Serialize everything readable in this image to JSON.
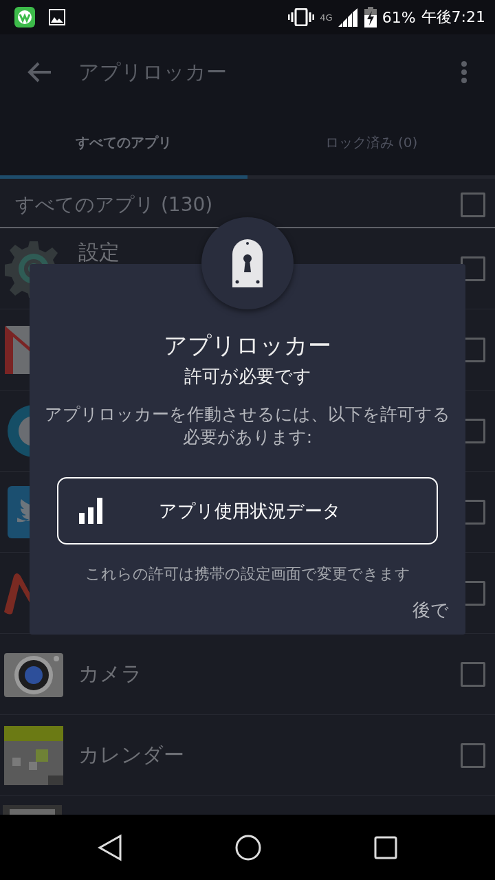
{
  "status_bar": {
    "network": "4G",
    "battery": "61%",
    "time": "午後7:21"
  },
  "app_bar": {
    "title": "アプリロッカー"
  },
  "tabs": [
    {
      "label": "すべてのアプリ",
      "selected": true
    },
    {
      "label": "ロック済み (0)",
      "selected": false
    }
  ],
  "section": {
    "title": "すべてのアプリ (130)",
    "checked": false
  },
  "apps": [
    {
      "name": "設定",
      "checked": false
    },
    {
      "checked": false
    },
    {
      "checked": false
    },
    {
      "checked": false
    },
    {
      "checked": false
    },
    {
      "name": "カメラ",
      "checked": false
    },
    {
      "name": "カレンダー",
      "checked": false
    }
  ],
  "dialog": {
    "title": "アプリロッカー",
    "subtitle": "許可が必要です",
    "message": "アプリロッカーを作動させるには、以下を許可する必要があります:",
    "permission": "アプリ使用状況データ",
    "note": "これらの許可は携帯の設定画面で変更できます",
    "later_button": "後で"
  }
}
